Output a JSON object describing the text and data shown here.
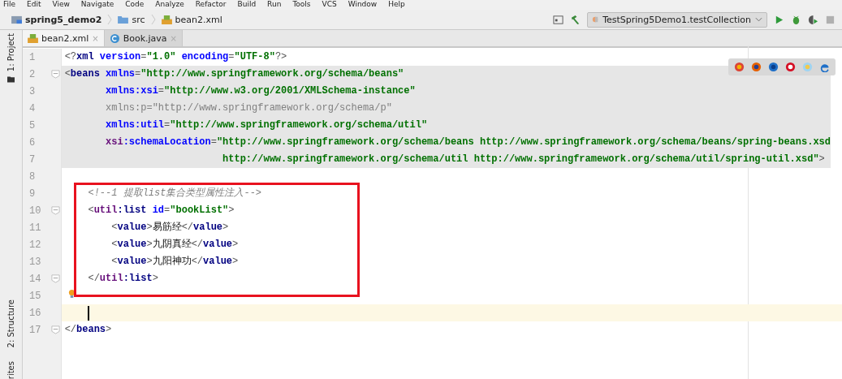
{
  "menu": [
    "File",
    "Edit",
    "View",
    "Navigate",
    "Code",
    "Analyze",
    "Refactor",
    "Build",
    "Run",
    "Tools",
    "VCS",
    "Window",
    "Help"
  ],
  "breadcrumb": [
    {
      "label": "spring5_demo2",
      "kind": "project"
    },
    {
      "label": "src",
      "kind": "folder"
    },
    {
      "label": "bean2.xml",
      "kind": "xml"
    }
  ],
  "run_config": {
    "label": "TestSpring5Demo1.testCollection"
  },
  "tabs": [
    {
      "label": "bean2.xml",
      "kind": "xml",
      "selected": true,
      "close": "×"
    },
    {
      "label": "Book.java",
      "kind": "class",
      "selected": false,
      "close": "×"
    }
  ],
  "side_tools_top": [
    "1: Project"
  ],
  "side_tools_bottom": [
    "2: Structure",
    "rites"
  ],
  "lines": [
    {
      "number": "1",
      "fold": false,
      "shaded": false,
      "current": false,
      "boxed": false,
      "bulb": false,
      "tokens": [
        {
          "kind": "punct",
          "text": "<?"
        },
        {
          "kind": "tag",
          "text": "xml"
        },
        {
          "kind": "attr",
          "text": " version"
        },
        {
          "kind": "punct",
          "text": "="
        },
        {
          "kind": "value",
          "text": "\"1.0\""
        },
        {
          "kind": "attr",
          "text": " encoding"
        },
        {
          "kind": "punct",
          "text": "="
        },
        {
          "kind": "value",
          "text": "\"UTF-8\""
        },
        {
          "kind": "punct",
          "text": "?>"
        }
      ]
    },
    {
      "number": "2",
      "fold": true,
      "shaded": true,
      "current": false,
      "boxed": false,
      "bulb": false,
      "tokens": [
        {
          "kind": "punct",
          "text": "<"
        },
        {
          "kind": "tag",
          "text": "beans"
        },
        {
          "kind": "attr",
          "text": " xmlns"
        },
        {
          "kind": "punct",
          "text": "="
        },
        {
          "kind": "value",
          "text": "\"http://www.springframework.org/schema/beans\""
        }
      ]
    },
    {
      "number": "3",
      "fold": false,
      "shaded": true,
      "current": false,
      "boxed": false,
      "bulb": false,
      "tokens": [
        {
          "kind": "attr",
          "text": "       xmlns:xsi"
        },
        {
          "kind": "punct",
          "text": "="
        },
        {
          "kind": "value",
          "text": "\"http://www.w3.org/2001/XMLSchema-instance\""
        }
      ]
    },
    {
      "number": "4",
      "fold": false,
      "shaded": true,
      "current": false,
      "boxed": false,
      "bulb": false,
      "tokens": [
        {
          "kind": "unused",
          "text": "       xmlns:p=\"http://www.springframework.org/schema/p\""
        }
      ]
    },
    {
      "number": "5",
      "fold": false,
      "shaded": true,
      "current": false,
      "boxed": false,
      "bulb": false,
      "tokens": [
        {
          "kind": "attr",
          "text": "       xmlns:util"
        },
        {
          "kind": "punct",
          "text": "="
        },
        {
          "kind": "value",
          "text": "\"http://www.springframework.org/schema/util\""
        }
      ]
    },
    {
      "number": "6",
      "fold": false,
      "shaded": true,
      "current": false,
      "boxed": false,
      "bulb": false,
      "tokens": [
        {
          "kind": "ns",
          "text": "       xsi"
        },
        {
          "kind": "attr",
          "text": ":schemaLocation"
        },
        {
          "kind": "punct",
          "text": "="
        },
        {
          "kind": "value",
          "text": "\"http://www.springframework.org/schema/beans http://www.springframework.org/schema/beans/spring-beans.xsd"
        }
      ]
    },
    {
      "number": "7",
      "fold": false,
      "shaded": true,
      "current": false,
      "boxed": false,
      "bulb": false,
      "tokens": [
        {
          "kind": "value",
          "text": "                           http://www.springframework.org/schema/util http://www.springframework.org/schema/util/spring-util.xsd\""
        },
        {
          "kind": "punct",
          "text": ">"
        }
      ]
    },
    {
      "number": "8",
      "fold": false,
      "shaded": false,
      "current": false,
      "boxed": false,
      "bulb": false
    },
    {
      "number": "9",
      "fold": false,
      "shaded": false,
      "current": false,
      "boxed": true,
      "bulb": false,
      "tokens": [
        {
          "kind": "comment",
          "text": "    <!--1 提取list集合类型属性注入-->"
        }
      ]
    },
    {
      "number": "10",
      "fold": true,
      "shaded": false,
      "current": false,
      "boxed": true,
      "bulb": false,
      "tokens": [
        {
          "kind": "punct",
          "text": "    <"
        },
        {
          "kind": "ns",
          "text": "util"
        },
        {
          "kind": "tag",
          "text": ":list"
        },
        {
          "kind": "attr",
          "text": " id"
        },
        {
          "kind": "punct",
          "text": "="
        },
        {
          "kind": "value",
          "text": "\"bookList\""
        },
        {
          "kind": "punct",
          "text": ">"
        }
      ]
    },
    {
      "number": "11",
      "fold": false,
      "shaded": false,
      "current": false,
      "boxed": true,
      "bulb": false,
      "tokens": [
        {
          "kind": "punct",
          "text": "        <"
        },
        {
          "kind": "tag",
          "text": "value"
        },
        {
          "kind": "punct",
          "text": ">"
        },
        {
          "kind": "text",
          "text": "易筋经"
        },
        {
          "kind": "punct",
          "text": "</"
        },
        {
          "kind": "tag",
          "text": "value"
        },
        {
          "kind": "punct",
          "text": ">"
        }
      ]
    },
    {
      "number": "12",
      "fold": false,
      "shaded": false,
      "current": false,
      "boxed": true,
      "bulb": false,
      "tokens": [
        {
          "kind": "punct",
          "text": "        <"
        },
        {
          "kind": "tag",
          "text": "value"
        },
        {
          "kind": "punct",
          "text": ">"
        },
        {
          "kind": "text",
          "text": "九阴真经"
        },
        {
          "kind": "punct",
          "text": "</"
        },
        {
          "kind": "tag",
          "text": "value"
        },
        {
          "kind": "punct",
          "text": ">"
        }
      ]
    },
    {
      "number": "13",
      "fold": false,
      "shaded": false,
      "current": false,
      "boxed": true,
      "bulb": false,
      "tokens": [
        {
          "kind": "punct",
          "text": "        <"
        },
        {
          "kind": "tag",
          "text": "value"
        },
        {
          "kind": "punct",
          "text": ">"
        },
        {
          "kind": "text",
          "text": "九阳神功"
        },
        {
          "kind": "punct",
          "text": "</"
        },
        {
          "kind": "tag",
          "text": "value"
        },
        {
          "kind": "punct",
          "text": ">"
        }
      ]
    },
    {
      "number": "14",
      "fold": true,
      "shaded": false,
      "current": false,
      "boxed": true,
      "bulb": false,
      "tokens": [
        {
          "kind": "punct",
          "text": "    </"
        },
        {
          "kind": "ns",
          "text": "util"
        },
        {
          "kind": "tag",
          "text": ":list"
        },
        {
          "kind": "punct",
          "text": ">"
        }
      ]
    },
    {
      "number": "15",
      "fold": false,
      "shaded": false,
      "current": false,
      "boxed": false,
      "bulb": true
    },
    {
      "number": "16",
      "fold": false,
      "shaded": false,
      "current": true,
      "boxed": false,
      "bulb": false
    },
    {
      "number": "17",
      "fold": true,
      "shaded": false,
      "current": false,
      "boxed": false,
      "bulb": false,
      "tokens": [
        {
          "kind": "punct",
          "text": "</"
        },
        {
          "kind": "tag",
          "text": "beans"
        },
        {
          "kind": "punct",
          "text": ">"
        }
      ]
    }
  ]
}
